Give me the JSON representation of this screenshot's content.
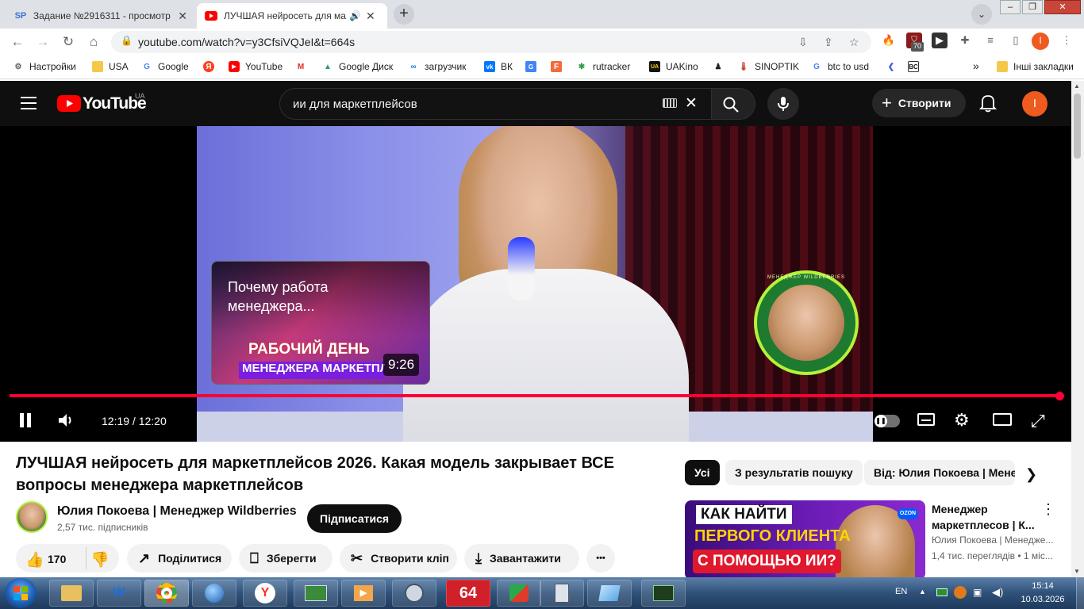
{
  "browser": {
    "tabs": [
      {
        "favicon": "SP",
        "title": "Задание №2916311 - просмотр",
        "active": false
      },
      {
        "favicon": "youtube-icon",
        "title": "ЛУЧШАЯ нейросеть для ма",
        "active": true
      }
    ],
    "new_tab": "+",
    "url": "youtube.com/watch?v=y3CfsiVQJeI&t=664s",
    "extensions_badge": "70",
    "profile_initial": "I"
  },
  "bookmarks": {
    "items": [
      "Настройки",
      "USA",
      "Google",
      "",
      "YouTube",
      "",
      "Google Диск",
      "загрузчик",
      "ВК",
      "",
      "",
      "rutracker",
      "UAKino",
      "",
      "SINOPTIK",
      "btc to usd",
      "",
      ""
    ],
    "overflow": "»",
    "other": "Інші закладки"
  },
  "youtube": {
    "logo_text": "YouTube",
    "logo_region": "UA",
    "search_value": "ии для маркетплейсов",
    "create_label": "Створити",
    "avatar_initial": "I",
    "player": {
      "time_current": "12:19",
      "time_separator": " / ",
      "time_total": "12:20",
      "progress_fraction": 0.999,
      "endscreen_card": {
        "title": "Почему работа менеджера...",
        "thumb_line1": "РАБОЧИЙ ДЕНЬ",
        "thumb_line2": "МЕНЕДЖЕРА МАРКЕТПЛЕЙ",
        "duration": "9:26"
      },
      "badge_ring_text": "МЕНЕДЖЕР WILDBERRIES"
    },
    "video": {
      "title": "ЛУЧШАЯ нейросеть для маркетплейсов 2026. Какая модель закрывает ВСЕ вопросы менеджера маркетплейсов",
      "channel": "Юлия Покоева | Менеджер Wildberries",
      "subscribers": "2,57 тис. підписників",
      "subscribe": "Підписатися",
      "likes": "170",
      "share": "Поділитися",
      "save": "Зберегти",
      "clip": "Створити кліп",
      "download": "Завантажити",
      "more": "•••"
    },
    "chips": [
      "Усі",
      "З результатів пошуку",
      "Від: Юлия Покоева | Менеджер Wildberries"
    ],
    "recommended": [
      {
        "title": "Менеджер маркетплесов | К...",
        "channel": "Юлия Покоева | Менедже...",
        "meta": "1,4 тис. переглядів • 1 міс...",
        "thumb_line1": "КАК НАЙТИ",
        "thumb_line2": "ПЕРВОГО КЛИЕНТА",
        "thumb_line3": "С ПОМОЩЬЮ ИИ?",
        "thumb_badge": "OZON"
      }
    ]
  },
  "taskbar": {
    "apps": [
      "",
      "",
      "",
      "",
      "",
      "",
      "",
      "",
      "64",
      "",
      "",
      "",
      ""
    ],
    "lang": "EN",
    "time": "15:14",
    "date": "10.03.2026"
  },
  "colors": {
    "yt_red": "#ff0000",
    "progress_red": "#ff0033",
    "masthead_bg": "#0f0f0f",
    "avatar_orange": "#ef5a1f"
  }
}
